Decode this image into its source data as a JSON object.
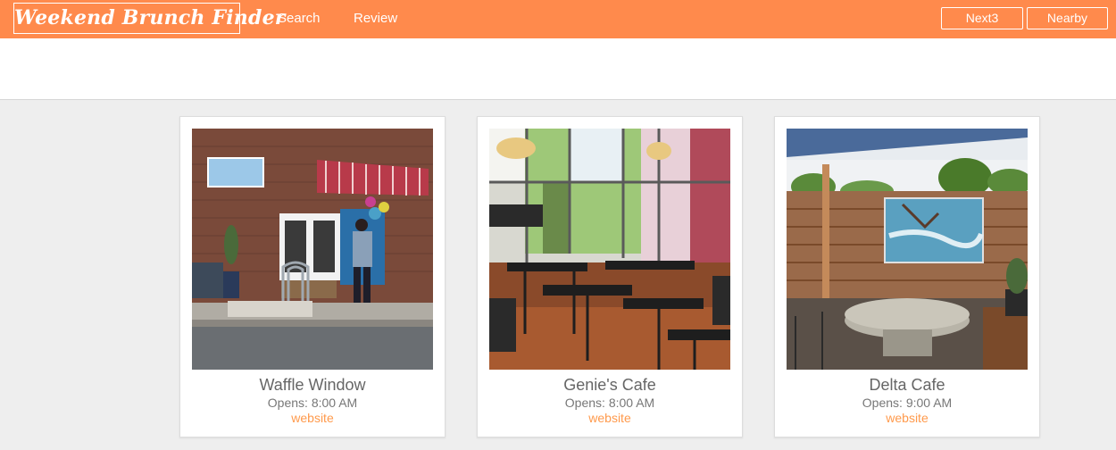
{
  "header": {
    "brand": "Weekend Brunch Finder",
    "nav": [
      "Search",
      "Review"
    ],
    "buttons": [
      "Next3",
      "Nearby"
    ],
    "color": "#ff8a4c"
  },
  "cards": [
    {
      "name": "Waffle Window",
      "hours": "Opens: 8:00 AM",
      "link": "website",
      "photo": "storefront-photo"
    },
    {
      "name": "Genie's Cafe",
      "hours": "Opens: 8:00 AM",
      "link": "website",
      "photo": "restaurant-interior-photo"
    },
    {
      "name": "Delta Cafe",
      "hours": "Opens: 9:00 AM",
      "link": "website",
      "photo": "patio-photo"
    }
  ]
}
